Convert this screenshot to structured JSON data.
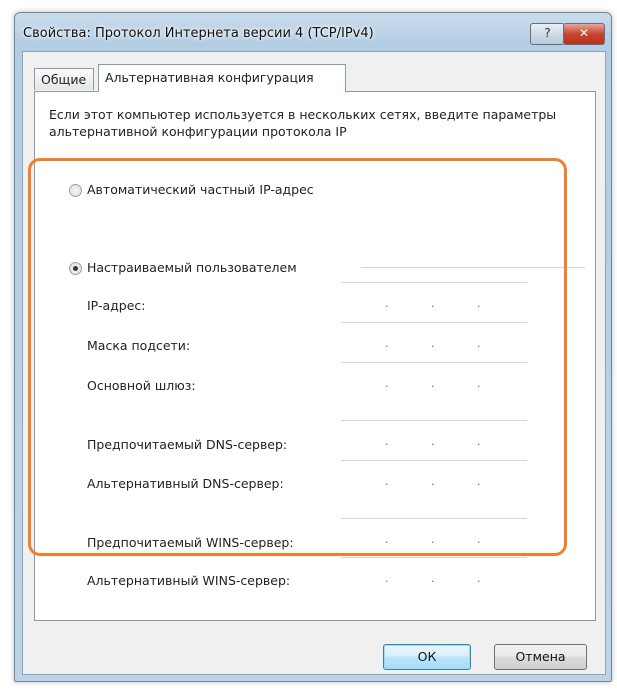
{
  "window": {
    "title": "Свойства: Протокол Интернета версии 4 (TCP/IPv4)",
    "help_label": "?",
    "close_label": "✕"
  },
  "tabs": [
    {
      "label": "Общие"
    },
    {
      "label": "Альтернативная конфигурация"
    }
  ],
  "description": "Если этот компьютер используется в нескольких сетях, введите параметры альтернативной конфигурации протокола IP",
  "options": {
    "auto_label": "Автоматический частный IP-адрес",
    "user_label": "Настраиваемый пользователем",
    "selected": "user"
  },
  "fields": [
    {
      "label": "IP-адрес:",
      "value": ""
    },
    {
      "label": "Маска подсети:",
      "value": ""
    },
    {
      "label": "Основной шлюз:",
      "value": ""
    },
    {
      "label": "Предпочитаемый DNS-сервер:",
      "value": ""
    },
    {
      "label": "Альтернативный DNS-сервер:",
      "value": ""
    },
    {
      "label": "Предпочитаемый WINS-сервер:",
      "value": ""
    },
    {
      "label": "Альтернативный WINS-сервер:",
      "value": ""
    }
  ],
  "ip_separator": ".",
  "buttons": {
    "ok_label": "ОК",
    "cancel_label": "Отмена"
  },
  "colors": {
    "highlight": "#f07f2c"
  }
}
